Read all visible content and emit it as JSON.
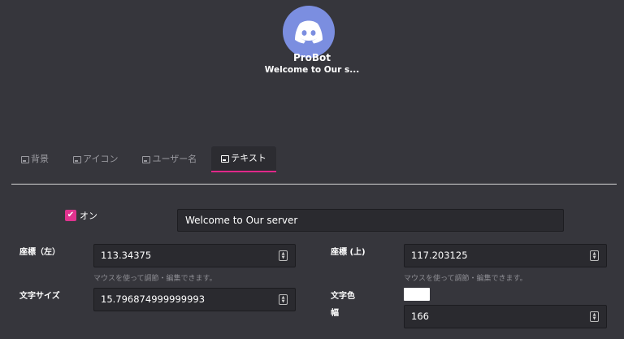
{
  "preview": {
    "bot_name": "ProBot",
    "welcome_title": "Welcome to Our s..."
  },
  "tabs": [
    {
      "label": "背景",
      "active": false
    },
    {
      "label": "アイコン",
      "active": false
    },
    {
      "label": "ユーザー名",
      "active": false
    },
    {
      "label": "テキスト",
      "active": true
    }
  ],
  "text_settings": {
    "enabled": true,
    "toggle_label": "オン",
    "text_value": "Welcome to Our server",
    "x_label": "座標（左）",
    "x_value": "113.34375",
    "x_hint": "マウスを使って調節・編集できます。",
    "y_label": "座標 (上)",
    "y_value": "117.203125",
    "y_hint": "マウスを使って調節・編集できます。",
    "size_label": "文字サイズ",
    "size_value": "15.796874999999993",
    "color_label": "文字色",
    "color_value": "#ffffff",
    "width_label": "幅",
    "width_value": "166"
  },
  "colors": {
    "background": "#36363c",
    "accent": "#e0288a",
    "avatar": "#7b8ee0",
    "input_bg": "#2a2a2f"
  }
}
